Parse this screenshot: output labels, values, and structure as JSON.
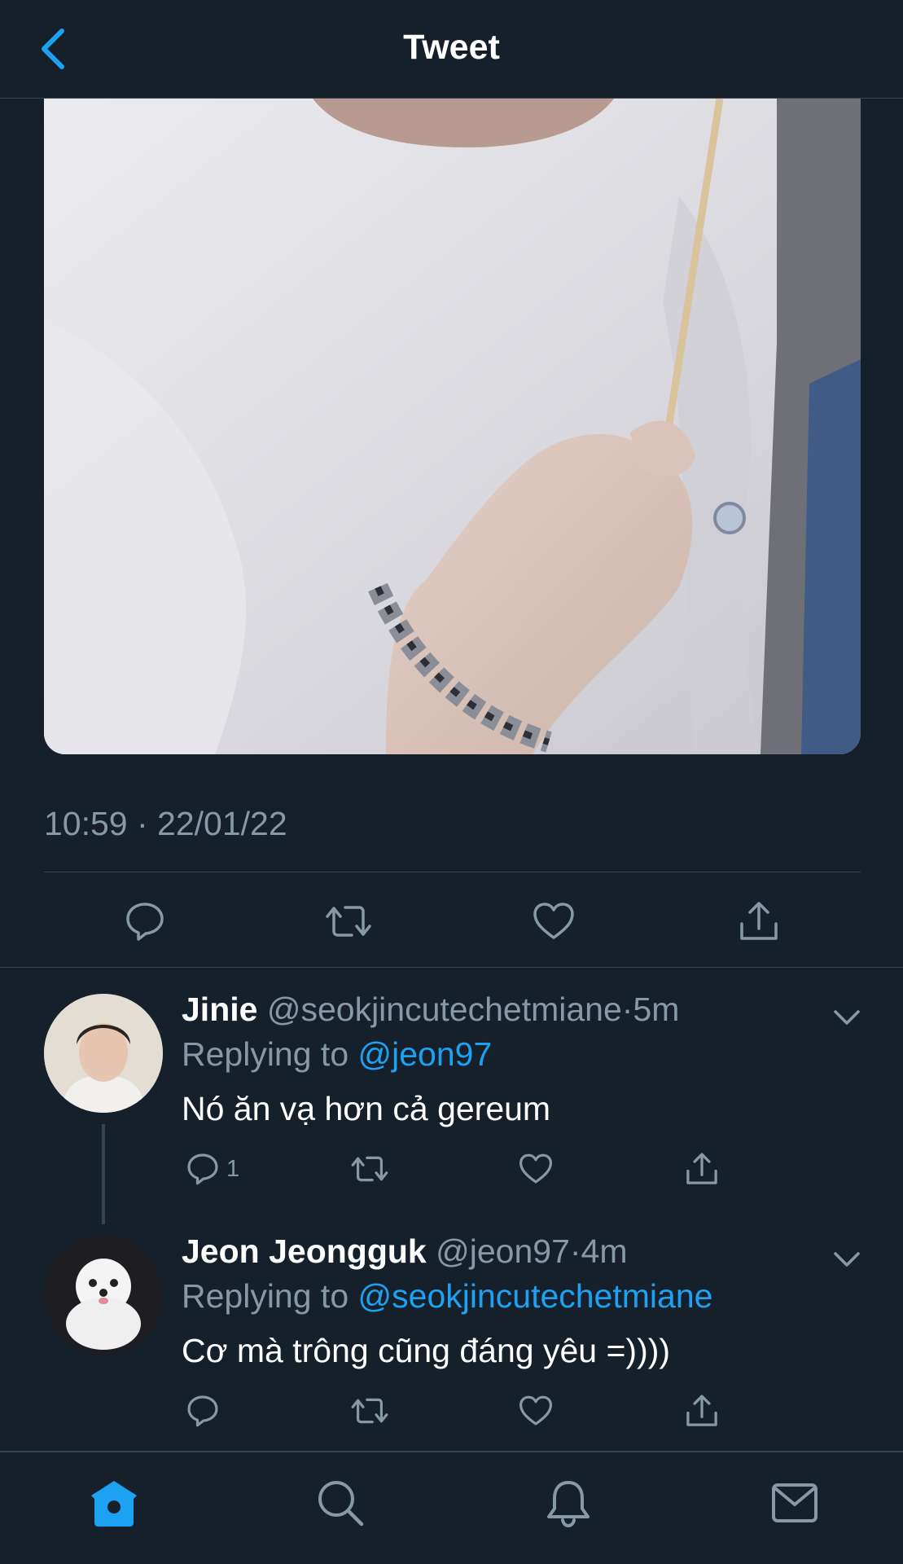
{
  "header": {
    "title": "Tweet",
    "back_icon": "chevron-left-icon"
  },
  "media": {
    "description_icon": "photo"
  },
  "tweet": {
    "timestamp": "10:59 · 22/01/22"
  },
  "replies": [
    {
      "name": "Jinie",
      "handle": "@seokjincutechetmiane",
      "separator": "·",
      "time": "5m",
      "replying_prefix": "Replying to ",
      "replying_to": "@jeon97",
      "text": "Nó ăn vạ hơn cả gereum",
      "reply_count": "1"
    },
    {
      "name": "Jeon Jeongguk",
      "handle": "@jeon97",
      "separator": "·",
      "time": "4m",
      "replying_prefix": "Replying to ",
      "replying_to": "@seokjincutechetmiane",
      "text": "Cơ mà trông cũng đáng yêu =))))",
      "reply_count": ""
    }
  ],
  "colors": {
    "background": "#15202b",
    "accent": "#1da1f2",
    "muted": "#8899a6",
    "divider": "#38444d"
  },
  "bottom_nav": [
    "home-icon",
    "search-icon",
    "bell-icon",
    "mail-icon"
  ]
}
